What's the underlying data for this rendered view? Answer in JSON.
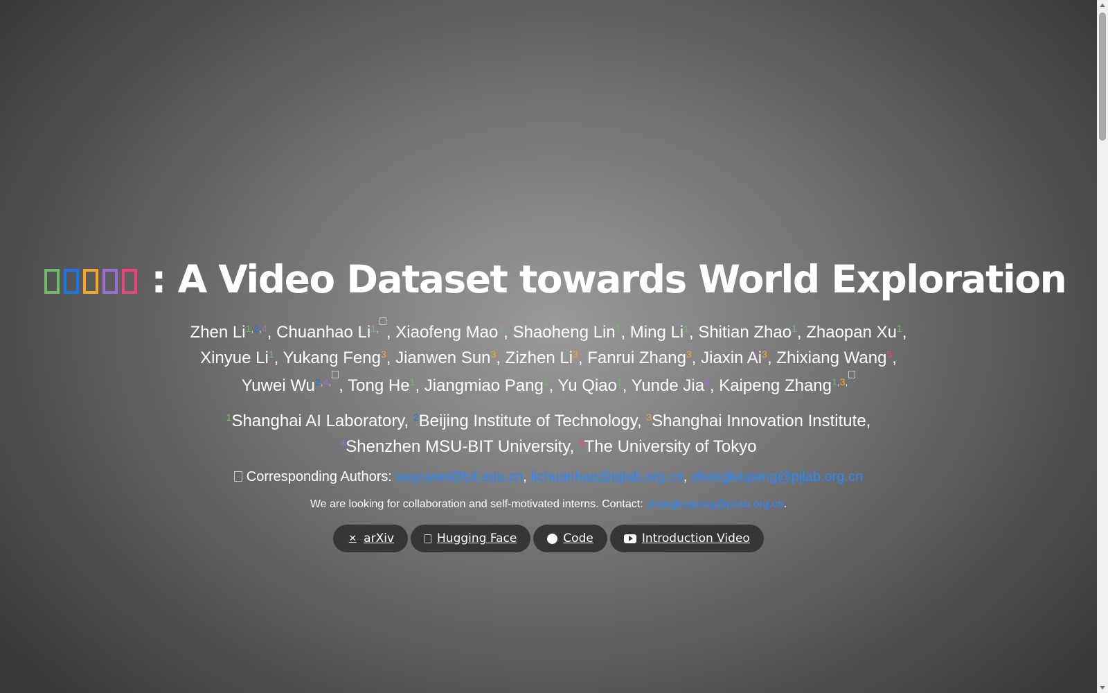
{
  "title": {
    "glyph_colors": [
      "#6dbd6a",
      "#1a73e8",
      "#f5a623",
      "#9b6fd6",
      "#e8457a"
    ],
    "text": ": A Video Dataset towards World Exploration"
  },
  "colors": {
    "aff1": "#6dbd6a",
    "aff2": "#1a73e8",
    "aff3": "#f5a623",
    "aff4": "#9b6fd6",
    "aff5": "#e8457a",
    "link": "#2a88ff"
  },
  "authors": [
    {
      "name": "Zhen Li",
      "marks": [
        "1",
        "2",
        "4"
      ]
    },
    {
      "name": "Chuanhao Li",
      "marks": [
        "1",
        "corresponding"
      ]
    },
    {
      "name": "Xiaofeng Mao",
      "marks": [
        "1"
      ]
    },
    {
      "name": "Shaoheng Lin",
      "marks": [
        "1"
      ]
    },
    {
      "name": "Ming Li",
      "marks": [
        "1"
      ]
    },
    {
      "name": "Shitian Zhao",
      "marks": [
        "1"
      ]
    },
    {
      "name": "Zhaopan Xu",
      "marks": [
        "1"
      ]
    },
    {
      "name": "Xinyue Li",
      "marks": [
        "1"
      ]
    },
    {
      "name": "Yukang Feng",
      "marks": [
        "3"
      ]
    },
    {
      "name": "Jianwen Sun",
      "marks": [
        "3"
      ]
    },
    {
      "name": "Zizhen Li",
      "marks": [
        "3"
      ]
    },
    {
      "name": "Fanrui Zhang",
      "marks": [
        "3"
      ]
    },
    {
      "name": "Jiaxin Ai",
      "marks": [
        "3"
      ]
    },
    {
      "name": "Zhixiang Wang",
      "marks": [
        "5"
      ]
    },
    {
      "name": "Yuwei Wu",
      "marks": [
        "2",
        "4",
        "corresponding"
      ]
    },
    {
      "name": "Tong He",
      "marks": [
        "1"
      ]
    },
    {
      "name": "Jiangmiao Pang",
      "marks": [
        "1"
      ]
    },
    {
      "name": "Yu Qiao",
      "marks": [
        "1"
      ]
    },
    {
      "name": "Yunde Jia",
      "marks": [
        "4"
      ]
    },
    {
      "name": "Kaipeng Zhang",
      "marks": [
        "1",
        "3",
        "corresponding"
      ]
    }
  ],
  "affiliations": [
    {
      "num": "1",
      "name": "Shanghai AI Laboratory"
    },
    {
      "num": "2",
      "name": "Beijing Institute of Technology"
    },
    {
      "num": "3",
      "name": "Shanghai Innovation Institute"
    },
    {
      "num": "4",
      "name": "Shenzhen MSU-BIT University"
    },
    {
      "num": "5",
      "name": "The University of Tokyo"
    }
  ],
  "corresponding": {
    "label": "Corresponding Authors:",
    "emails": [
      "wuyuwei@bit.edu.cn",
      "lichuanhao@pjlab.org.cn",
      "zhangkaipeng@pjlab.org.cn"
    ]
  },
  "collab": {
    "text": "We are looking for collaboration and self-motivated interns. Contact: ",
    "email": "zhangkaipeng@pjlab.org.cn",
    "suffix": "."
  },
  "buttons": [
    {
      "label": "arXiv",
      "icon": "arxiv-icon"
    },
    {
      "label": "Hugging Face",
      "icon": "hugging-face-icon"
    },
    {
      "label": "Code",
      "icon": "github-icon"
    },
    {
      "label": "Introduction Video",
      "icon": "youtube-icon"
    }
  ]
}
